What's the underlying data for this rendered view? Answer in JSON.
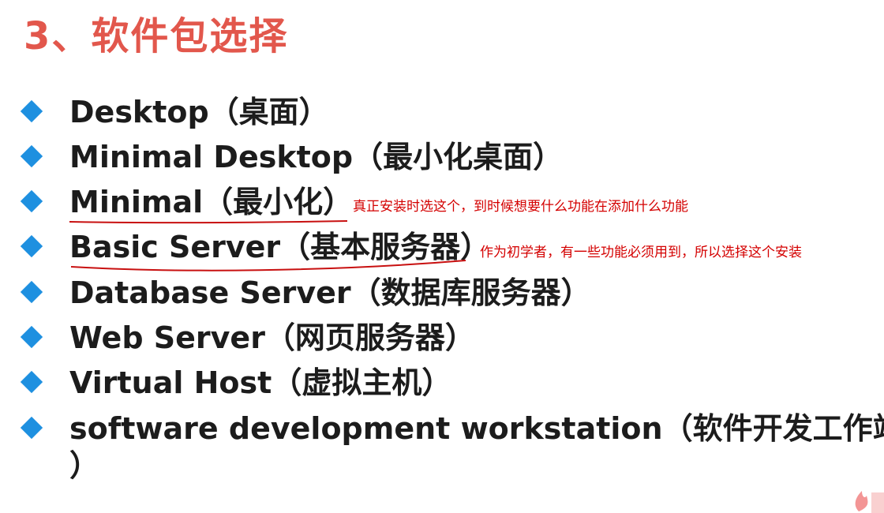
{
  "title": "3、软件包选择",
  "items": [
    {
      "label": "Desktop（桌面）"
    },
    {
      "label": "Minimal Desktop（最小化桌面）"
    },
    {
      "label": "Minimal（最小化）",
      "note": "真正安装时选这个，到时候想要什么功能在添加什么功能"
    },
    {
      "label": "Basic Server（基本服务器）",
      "note": "作为初学者，有一些功能必须用到，所以选择这个安装"
    },
    {
      "label": "Database Server（数据库服务器）"
    },
    {
      "label": "Web Server（网页服务器）"
    },
    {
      "label": "Virtual Host（虚拟主机）"
    },
    {
      "label": "software development workstation（软件开发工作站",
      "continuation": "）"
    }
  ],
  "colors": {
    "title": "#e2574c",
    "bullet": "#1e90e0",
    "annotation": "#d40000"
  },
  "icons": {
    "bullet": "diamond-bullet-icon",
    "logo": "flame-logo-icon"
  }
}
